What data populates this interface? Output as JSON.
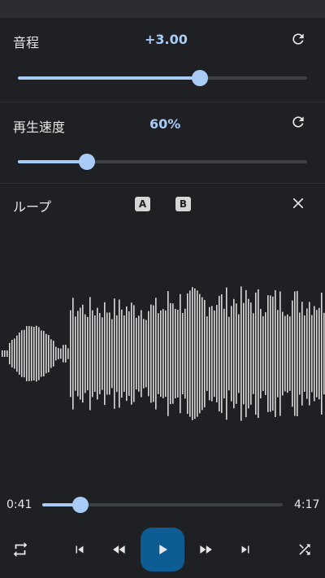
{
  "pitch": {
    "label": "音程",
    "value": "+3.00",
    "level_fraction": 0.63
  },
  "speed": {
    "label": "再生速度",
    "value": "60%",
    "level_fraction": 0.24
  },
  "loop": {
    "label": "ループ",
    "a_label": "A",
    "b_label": "B"
  },
  "playback": {
    "current_time": "0:41",
    "total_time": "4:17",
    "progress_fraction": 0.16
  },
  "colors": {
    "accent": "#a9ccf6",
    "play_button": "#0d5d94",
    "background": "#1f2023",
    "waveform": "#d9d9d9"
  },
  "icons": {
    "pitch_reset": "refresh-icon",
    "speed_reset": "refresh-icon",
    "loop_close": "close-icon",
    "repeat": "repeat-icon",
    "skip_previous": "skip-previous-icon",
    "rewind": "rewind-icon",
    "play": "play-icon",
    "fast_forward": "fast-forward-icon",
    "skip_next": "skip-next-icon",
    "shuffle": "shuffle-icon"
  }
}
